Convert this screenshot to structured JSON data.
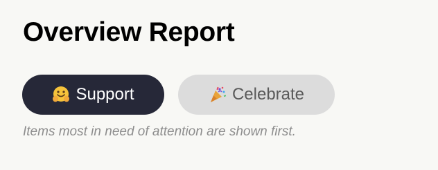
{
  "header": {
    "title": "Overview Report"
  },
  "toggles": [
    {
      "label": "Support",
      "icon": "hugging-face-emoji-icon",
      "selected": true
    },
    {
      "label": "Celebrate",
      "icon": "party-popper-emoji-icon",
      "selected": false
    }
  ],
  "hint": "Items most in need of attention are shown first.",
  "colors": {
    "background": "#f8f8f5",
    "selected_pill": "#262838",
    "unselected_pill": "#dcdcdc",
    "hint_text": "#8d8d8d"
  }
}
